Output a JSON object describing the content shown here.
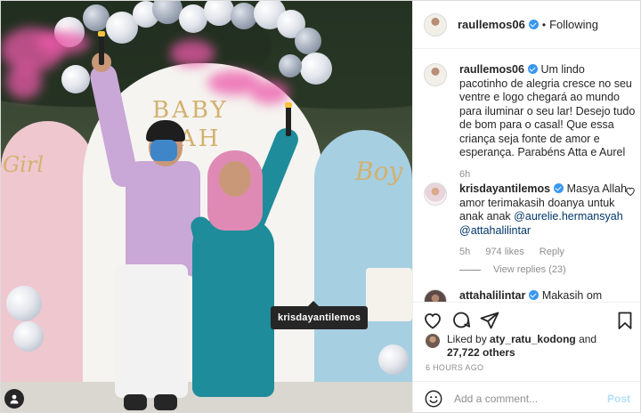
{
  "header": {
    "username": "raullemos06",
    "separator": "•",
    "follow_status": "Following"
  },
  "photo": {
    "decor": {
      "baby_line1": "BABY",
      "baby_line2": "AH",
      "girl_sign": "Girl",
      "boy_sign": "Boy"
    },
    "user_tag": "krisdayantilemos"
  },
  "caption": {
    "username": "raullemos06",
    "text": "Um lindo pacotinho de alegria cresce no seu ventre e logo chegará ao mundo para iluminar o seu lar! Desejo tudo de bom para o casal! Que essa criança seja fonte de amor e esperança. Parabéns Atta e Aurel",
    "age": "6h"
  },
  "comment1": {
    "username": "krisdayantilemos",
    "text": "Masya Allah amor terimakasih doanya untuk anak anak",
    "mention1": "@aurelie.hermansyah",
    "mention2": "@attahalilintar",
    "age": "5h",
    "likes": "974 likes",
    "reply": "Reply",
    "view_replies": "View replies (23)"
  },
  "comment2": {
    "username": "attahalilintar",
    "text": "Makasih om"
  },
  "likes": {
    "prefix": "Liked by",
    "user": "aty_ratu_kodong",
    "and": "and",
    "others": "27,722 others"
  },
  "timestamp": "6 HOURS AGO",
  "add_comment": {
    "placeholder": "Add a comment...",
    "post_label": "Post"
  },
  "icons": {
    "like": "heart-icon",
    "comment": "comment-icon",
    "share": "share-icon",
    "save": "bookmark-icon",
    "emoji": "emoji-icon",
    "tag": "user-tag-icon"
  },
  "colors": {
    "verified": "#3897f0",
    "link": "#00376b",
    "muted": "#8e8e8e",
    "post_button": "#b2dffc"
  }
}
